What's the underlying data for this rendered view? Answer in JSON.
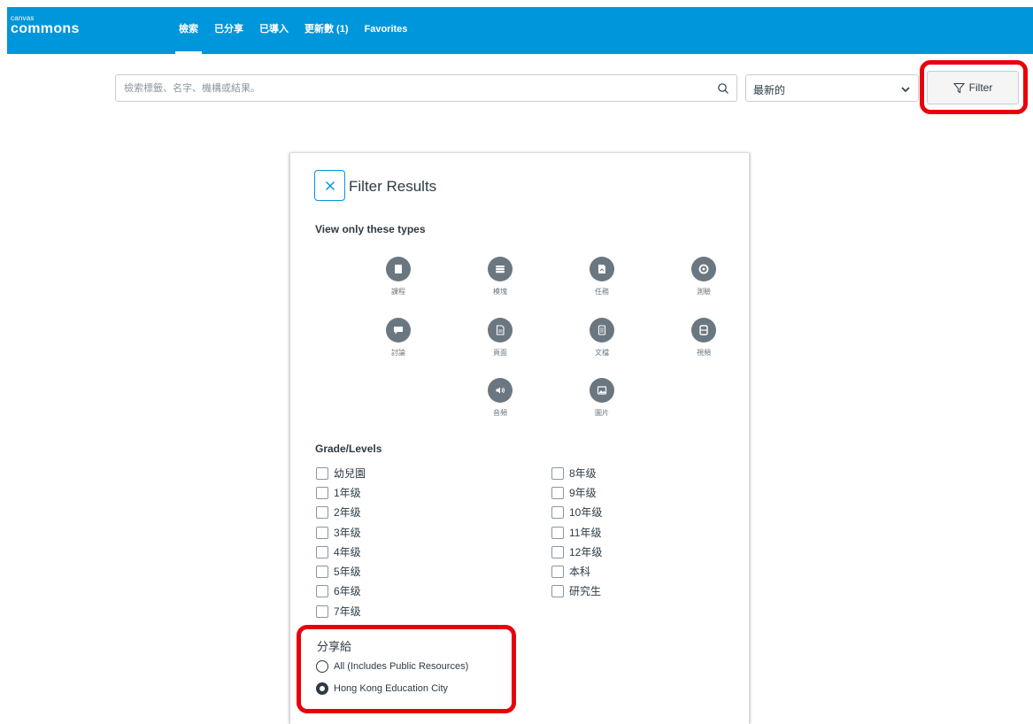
{
  "brand": {
    "small": "canvas",
    "big": "commons"
  },
  "nav": {
    "items": [
      {
        "label": "檢索"
      },
      {
        "label": "已分享"
      },
      {
        "label": "已導入"
      },
      {
        "label": "更新數 (1)"
      },
      {
        "label": "Favorites"
      }
    ]
  },
  "search": {
    "placeholder": "檢索標籤、名字、機構或結果。"
  },
  "sort": {
    "selected": "最新的"
  },
  "filter_button": {
    "label": "Filter"
  },
  "panel": {
    "title": "Filter Results",
    "types_heading": "View only these types",
    "types": [
      {
        "label": "課程",
        "icon": "course-icon"
      },
      {
        "label": "模塊",
        "icon": "module-icon"
      },
      {
        "label": "任務",
        "icon": "assignment-icon"
      },
      {
        "label": "測驗",
        "icon": "quiz-icon"
      },
      {
        "label": "討論",
        "icon": "discussion-icon"
      },
      {
        "label": "頁面",
        "icon": "page-icon"
      },
      {
        "label": "文檔",
        "icon": "document-icon"
      },
      {
        "label": "視頻",
        "icon": "video-icon"
      },
      {
        "label": "音頻",
        "icon": "audio-icon"
      },
      {
        "label": "圖片",
        "icon": "image-icon"
      }
    ],
    "grades_heading": "Grade/Levels",
    "grades_left": [
      "幼兒園",
      "1年级",
      "2年级",
      "3年级",
      "4年级",
      "5年级",
      "6年级",
      "7年级"
    ],
    "grades_right": [
      "8年级",
      "9年级",
      "10年级",
      "11年级",
      "12年级",
      "本科",
      "研究生"
    ],
    "share_heading": "分享給",
    "share_options": [
      {
        "label": "All (Includes Public Resources)",
        "checked": false
      },
      {
        "label": "Hong Kong Education City",
        "checked": true
      }
    ]
  },
  "colors": {
    "nav": "#0096db",
    "highlight": "#e8000b",
    "icon_bg": "#6b7780"
  }
}
